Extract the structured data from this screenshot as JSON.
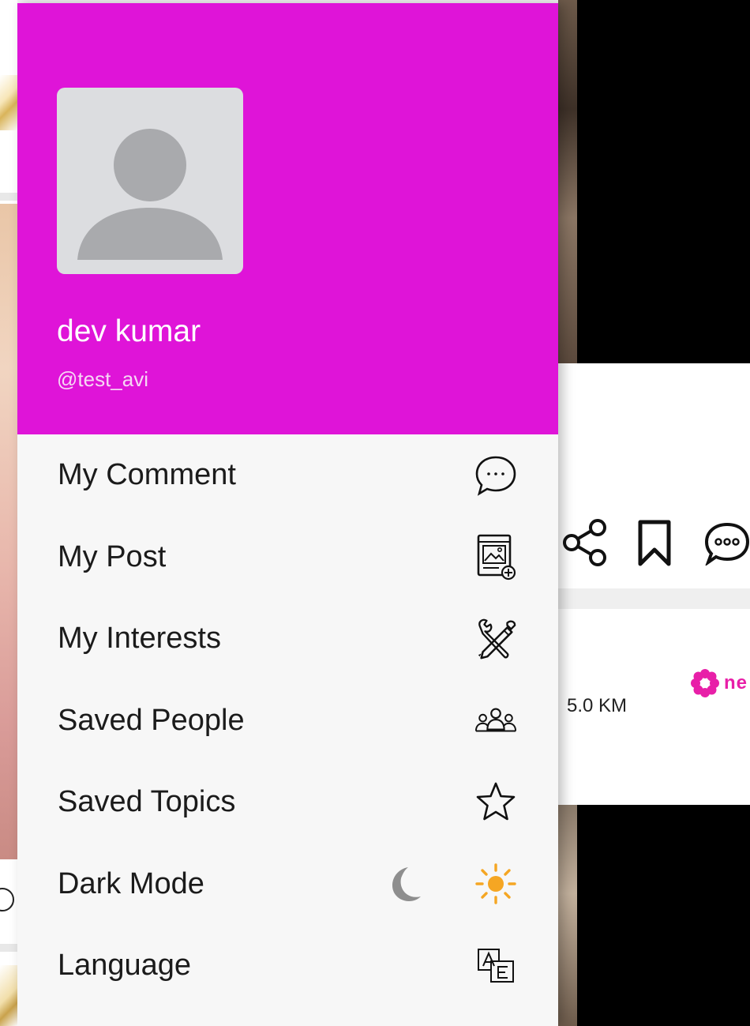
{
  "profile": {
    "name": "dev kumar",
    "handle": "@test_avi"
  },
  "menu": {
    "items": [
      {
        "label": "My Comment",
        "icon": "comment-icon"
      },
      {
        "label": "My Post",
        "icon": "post-icon"
      },
      {
        "label": "My Interests",
        "icon": "interests-icon"
      },
      {
        "label": "Saved People",
        "icon": "people-icon"
      },
      {
        "label": "Saved Topics",
        "icon": "star-icon"
      },
      {
        "label": "Dark Mode",
        "icon": "sun-icon",
        "secondary_icon": "moon-icon"
      },
      {
        "label": "Language",
        "icon": "language-icon"
      }
    ]
  },
  "background_feed": {
    "distance": "5.0 KM",
    "brand_text": "ne"
  },
  "colors": {
    "header": "#df14d8",
    "sun": "#f5a623",
    "moon": "#8e8e8e",
    "brand": "#e81fa8"
  }
}
